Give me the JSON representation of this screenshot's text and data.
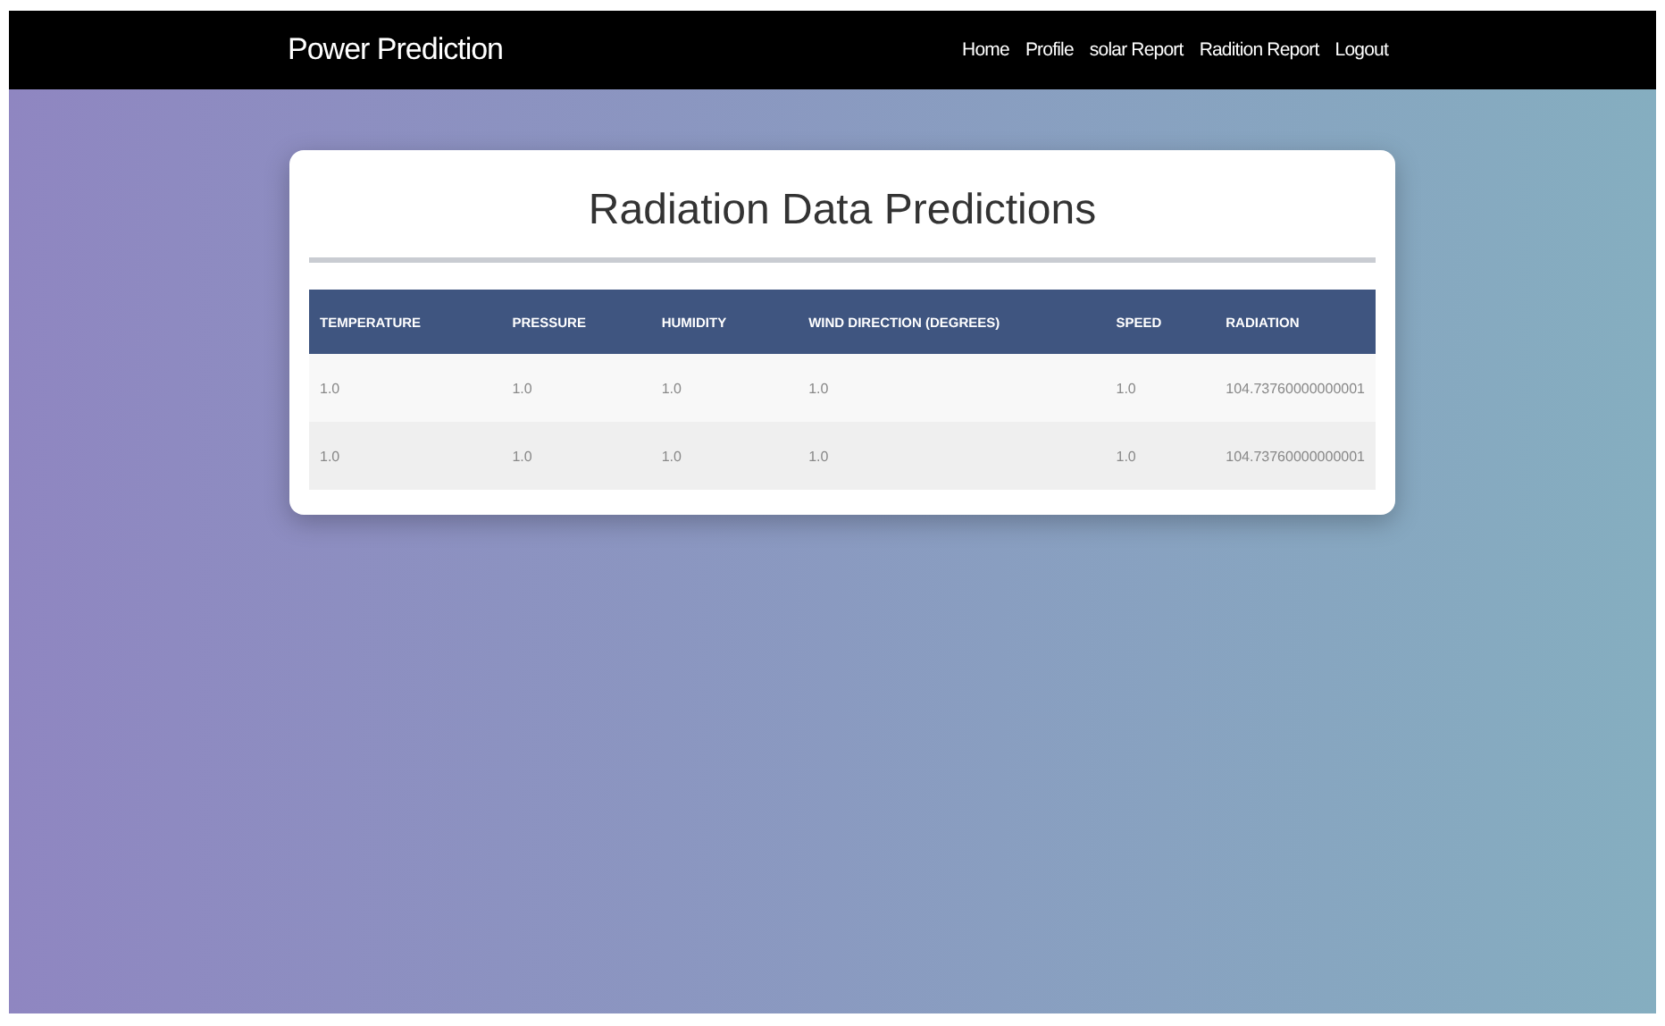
{
  "navbar": {
    "brand": "Power Prediction",
    "links": [
      "Home",
      "Profile",
      "solar Report",
      "Radition Report",
      "Logout"
    ]
  },
  "card": {
    "title": "Radiation Data Predictions",
    "table": {
      "columns": [
        "TEMPERATURE",
        "PRESSURE",
        "HUMIDITY",
        "WIND DIRECTION (DEGREES)",
        "SPEED",
        "RADIATION"
      ],
      "rows": [
        [
          "1.0",
          "1.0",
          "1.0",
          "1.0",
          "1.0",
          "104.73760000000001"
        ],
        [
          "1.0",
          "1.0",
          "1.0",
          "1.0",
          "1.0",
          "104.73760000000001"
        ]
      ]
    }
  }
}
